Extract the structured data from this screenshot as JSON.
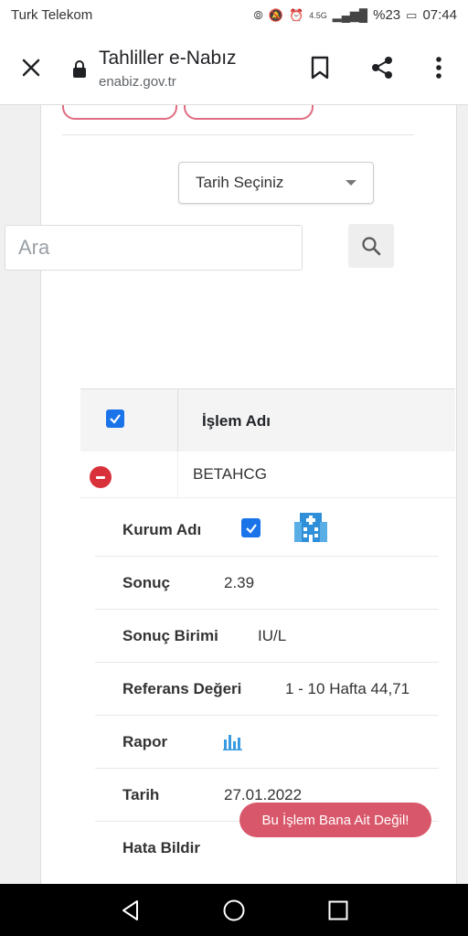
{
  "status_bar": {
    "carrier": "Turk Telekom",
    "battery": "%23",
    "time": "07:44",
    "network": "4.5G"
  },
  "app_bar": {
    "title": "Tahliller e-Nabız",
    "url": "enabiz.gov.tr"
  },
  "filters": {
    "date_select_label": "Tarih Seçiniz",
    "search_placeholder": "Ara"
  },
  "table": {
    "header_label": "İşlem Adı",
    "row_value": "BETAHCG"
  },
  "details": [
    {
      "key": "Kurum Adı",
      "value": ""
    },
    {
      "key": "Sonuç",
      "value": "2.39"
    },
    {
      "key": "Sonuç Birimi",
      "value": "IU/L"
    },
    {
      "key": "Referans Değeri",
      "value": "1 - 10 Hafta 44,71"
    },
    {
      "key": "Rapor",
      "value": ""
    },
    {
      "key": "Tarih",
      "value": "27.01.2022"
    },
    {
      "key": "Hata Bildir",
      "value": ""
    }
  ],
  "report_error_button": "Bu İşlem Bana Ait Değil!",
  "colors": {
    "accent": "#1a73e8",
    "danger": "#d9313a",
    "report_button": "#d9576a",
    "pill_border": "#e06c80"
  }
}
